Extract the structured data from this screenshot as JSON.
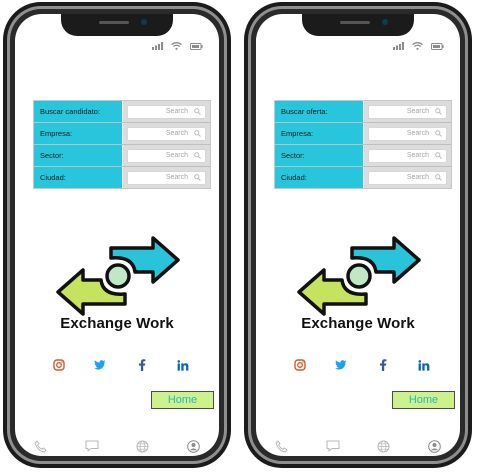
{
  "phones": [
    {
      "form": [
        {
          "label": "Buscar candidato:",
          "placeholder": "Search"
        },
        {
          "label": "Empresa:",
          "placeholder": "Search"
        },
        {
          "label": "Sector:",
          "placeholder": "Search"
        },
        {
          "label": "Ciudad:",
          "placeholder": "Search"
        }
      ],
      "brand": "Exchange Work",
      "home_label": "Home"
    },
    {
      "form": [
        {
          "label": "Buscar oferta:",
          "placeholder": "Search"
        },
        {
          "label": "Empresa:",
          "placeholder": "Search"
        },
        {
          "label": "Sector:",
          "placeholder": "Search"
        },
        {
          "label": "Ciudad:",
          "placeholder": "Search"
        }
      ],
      "brand": "Exchange Work",
      "home_label": "Home"
    }
  ],
  "icons": {
    "status": [
      "signal-icon",
      "wifi-icon",
      "battery-icon"
    ],
    "social": [
      "instagram-icon",
      "twitter-icon",
      "facebook-icon",
      "linkedin-icon"
    ],
    "nav": [
      "phone-icon",
      "chat-icon",
      "globe-icon",
      "profile-icon"
    ]
  },
  "colors": {
    "form_label_bg": "#27c6dd",
    "home_button_bg": "#cef28b",
    "home_button_text": "#25b5cc",
    "logo_green": "#c5e35f",
    "logo_cyan": "#29c3da",
    "instagram": "#d15a2a",
    "twitter": "#1da1f2",
    "facebook": "#3b5998",
    "linkedin": "#0a66c2"
  }
}
